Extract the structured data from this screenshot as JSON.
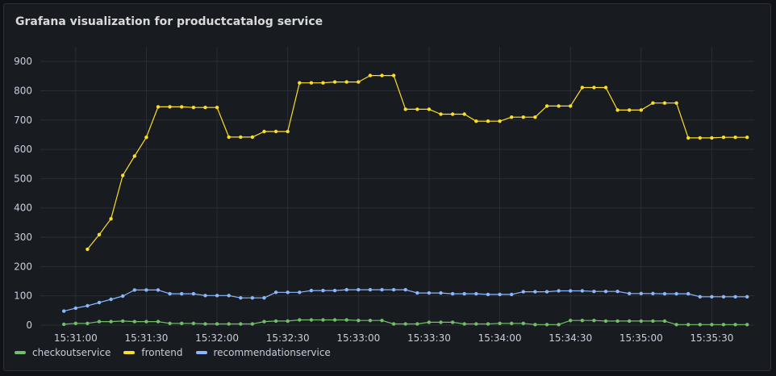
{
  "panel": {
    "title": "Grafana visualization for productcatalog service"
  },
  "colors": {
    "background": "#111217",
    "panel": "#181b1f",
    "grid": "#2a2d33",
    "checkoutservice": "#73bf69",
    "frontend": "#fade2a",
    "recommendationservice": "#8ab8ff"
  },
  "chart_data": {
    "type": "line",
    "title": "Grafana visualization for productcatalog service",
    "xlabel": "",
    "ylabel": "",
    "ylim": [
      0,
      950
    ],
    "xlim": [
      "15:30:45",
      "15:35:48"
    ],
    "y_ticks": [
      0,
      100,
      200,
      300,
      400,
      500,
      600,
      700,
      800,
      900
    ],
    "x_ticks": [
      "15:31:00",
      "15:31:30",
      "15:32:00",
      "15:32:30",
      "15:33:00",
      "15:33:30",
      "15:34:00",
      "15:34:30",
      "15:35:00",
      "15:35:30"
    ],
    "grid": true,
    "legend_position": "bottom-left",
    "x": [
      "15:30:55",
      "15:31:00",
      "15:31:05",
      "15:31:10",
      "15:31:15",
      "15:31:20",
      "15:31:25",
      "15:31:30",
      "15:31:35",
      "15:31:40",
      "15:31:45",
      "15:31:50",
      "15:31:55",
      "15:32:00",
      "15:32:05",
      "15:32:10",
      "15:32:15",
      "15:32:20",
      "15:32:25",
      "15:32:30",
      "15:32:35",
      "15:32:40",
      "15:32:45",
      "15:32:50",
      "15:32:55",
      "15:33:00",
      "15:33:05",
      "15:33:10",
      "15:33:15",
      "15:33:20",
      "15:33:25",
      "15:33:30",
      "15:33:35",
      "15:33:40",
      "15:33:45",
      "15:33:50",
      "15:33:55",
      "15:34:00",
      "15:34:05",
      "15:34:10",
      "15:34:15",
      "15:34:20",
      "15:34:25",
      "15:34:30",
      "15:34:35",
      "15:34:40",
      "15:34:45",
      "15:34:50",
      "15:34:55",
      "15:35:00",
      "15:35:05",
      "15:35:10",
      "15:35:15",
      "15:35:20",
      "15:35:25",
      "15:35:30",
      "15:35:35",
      "15:35:40",
      "15:35:45"
    ],
    "series": [
      {
        "name": "checkoutservice",
        "color": "#73bf69",
        "values": [
          3,
          6,
          6,
          12,
          12,
          14,
          12,
          12,
          12,
          6,
          6,
          6,
          4,
          4,
          4,
          4,
          4,
          12,
          14,
          14,
          18,
          18,
          18,
          18,
          18,
          16,
          16,
          16,
          4,
          4,
          4,
          10,
          10,
          10,
          4,
          4,
          4,
          6,
          6,
          6,
          2,
          2,
          2,
          16,
          16,
          16,
          14,
          14,
          14,
          14,
          14,
          14,
          2,
          2,
          2,
          2,
          2,
          2,
          2
        ]
      },
      {
        "name": "frontend",
        "color": "#fade2a",
        "values": [
          null,
          null,
          259,
          309,
          363,
          511,
          577,
          641,
          745,
          745,
          745,
          743,
          743,
          743,
          642,
          642,
          642,
          661,
          661,
          661,
          827,
          827,
          827,
          830,
          830,
          830,
          852,
          852,
          852,
          737,
          737,
          737,
          720,
          720,
          720,
          696,
          696,
          696,
          710,
          710,
          710,
          748,
          748,
          748,
          811,
          811,
          811,
          734,
          734,
          734,
          758,
          758,
          758,
          639,
          639,
          639,
          641,
          641,
          641
        ]
      },
      {
        "name": "recommendationservice",
        "color": "#8ab8ff",
        "values": [
          48,
          58,
          66,
          77,
          88,
          99,
          120,
          120,
          120,
          107,
          107,
          107,
          101,
          101,
          101,
          93,
          93,
          93,
          112,
          112,
          112,
          118,
          118,
          118,
          121,
          121,
          121,
          121,
          121,
          121,
          110,
          110,
          110,
          107,
          107,
          107,
          105,
          105,
          105,
          114,
          114,
          114,
          117,
          117,
          117,
          115,
          115,
          115,
          108,
          108,
          108,
          107,
          107,
          107,
          97,
          97,
          97,
          97,
          97
        ]
      }
    ]
  },
  "legend": [
    {
      "label": "checkoutservice",
      "color": "#73bf69"
    },
    {
      "label": "frontend",
      "color": "#fade2a"
    },
    {
      "label": "recommendationservice",
      "color": "#8ab8ff"
    }
  ]
}
